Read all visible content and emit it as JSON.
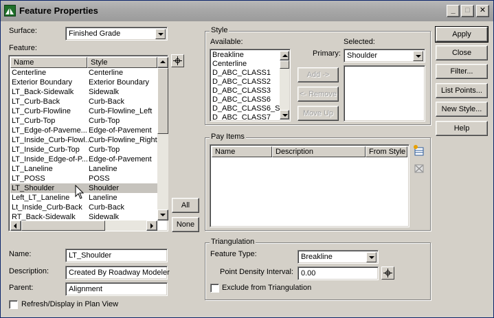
{
  "window": {
    "title": "Feature Properties",
    "minimize": "_",
    "maximize": "□",
    "close": "✕"
  },
  "surface": {
    "label": "Surface:",
    "value": "Finished Grade"
  },
  "feature": {
    "label": "Feature:",
    "columns": [
      "Name",
      "Style"
    ],
    "rows": [
      {
        "name": "Centerline",
        "style": "Centerline"
      },
      {
        "name": "Exterior Boundary",
        "style": "Exterior Boundary"
      },
      {
        "name": "LT_Back-Sidewalk",
        "style": "Sidewalk"
      },
      {
        "name": "LT_Curb-Back",
        "style": "Curb-Back"
      },
      {
        "name": "LT_Curb-Flowline",
        "style": "Curb-Flowline_Left"
      },
      {
        "name": "LT_Curb-Top",
        "style": "Curb-Top"
      },
      {
        "name": "LT_Edge-of-Paveme...",
        "style": "Edge-of-Pavement"
      },
      {
        "name": "LT_Inside_Curb-Flowl...",
        "style": "Curb-Flowline_Right"
      },
      {
        "name": "LT_Inside_Curb-Top",
        "style": "Curb-Top"
      },
      {
        "name": "LT_Inside_Edge-of-P...",
        "style": "Edge-of-Pavement"
      },
      {
        "name": "LT_Laneline",
        "style": "Laneline"
      },
      {
        "name": "LT_POSS",
        "style": "POSS"
      },
      {
        "name": "LT_Shoulder",
        "style": "Shoulder"
      },
      {
        "name": "Left_LT_Laneline",
        "style": "Laneline"
      },
      {
        "name": "Lt_Inside_Curb-Back",
        "style": "Curb-Back"
      },
      {
        "name": "RT_Back-Sidewalk",
        "style": "Sidewalk"
      }
    ],
    "selected_index": 12,
    "all_button": "All",
    "none_button": "None"
  },
  "details": {
    "name_label": "Name:",
    "name_value": "LT_Shoulder",
    "description_label": "Description:",
    "description_value": "Created By Roadway Modeler",
    "parent_label": "Parent:",
    "parent_value": "Alignment",
    "refresh_label": "Refresh/Display in Plan View"
  },
  "style": {
    "group_title": "Style",
    "available_label": "Available:",
    "available": [
      "Breakline",
      "Centerline",
      "D_ABC_CLASS1",
      "D_ABC_CLASS2",
      "D_ABC_CLASS3",
      "D_ABC_CLASS6",
      "D_ABC_CLASS6_S",
      "D_ABC_CLASS7"
    ],
    "selected_label": "Selected:",
    "primary_label": "Primary:",
    "primary_value": "Shoulder",
    "add_button": "Add ->",
    "remove_button": "<- Remove",
    "moveup_button": "Move Up"
  },
  "pay_items": {
    "group_title": "Pay Items",
    "columns": [
      "Name",
      "Description",
      "From Style"
    ]
  },
  "triangulation": {
    "group_title": "Triangulation",
    "feature_type_label": "Feature Type:",
    "feature_type_value": "Breakline",
    "density_label": "Point Density Interval:",
    "density_value": "0.00",
    "exclude_label": "Exclude from Triangulation"
  },
  "actions": {
    "apply": "Apply",
    "close": "Close",
    "filter": "Filter...",
    "list_points": "List Points...",
    "new_style": "New Style...",
    "help": "Help"
  }
}
